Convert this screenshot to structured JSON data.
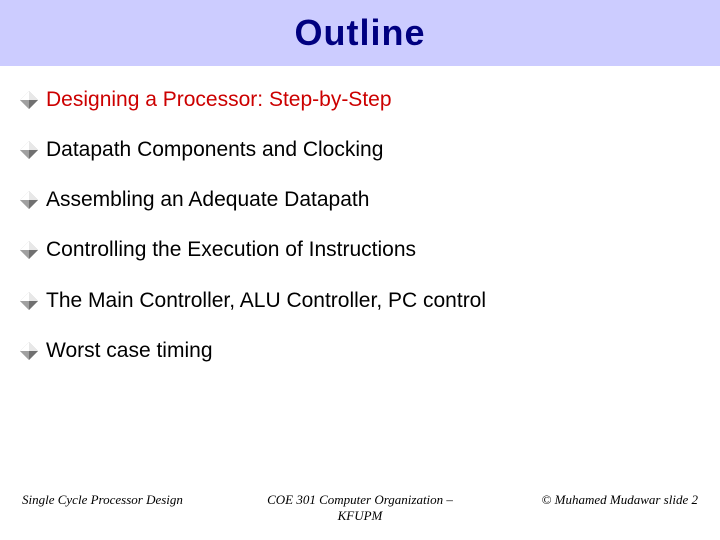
{
  "title": "Outline",
  "bullets": [
    {
      "text": "Designing a Processor: Step-by-Step",
      "link": true
    },
    {
      "text": "Datapath Components and Clocking",
      "link": false
    },
    {
      "text": "Assembling an Adequate Datapath",
      "link": false
    },
    {
      "text": "Controlling the Execution of Instructions",
      "link": false
    },
    {
      "text": "The Main Controller, ALU Controller, PC control",
      "link": false
    },
    {
      "text": "Worst case timing",
      "link": false
    }
  ],
  "footer": {
    "left": "Single Cycle Processor Design",
    "center": "COE 301 Computer Organization – KFUPM",
    "right": "© Muhamed Mudawar  slide 2"
  },
  "colors": {
    "title_band": "#ccccff",
    "title_text": "#000080",
    "link_text": "#cc0000",
    "body_text": "#000000"
  }
}
